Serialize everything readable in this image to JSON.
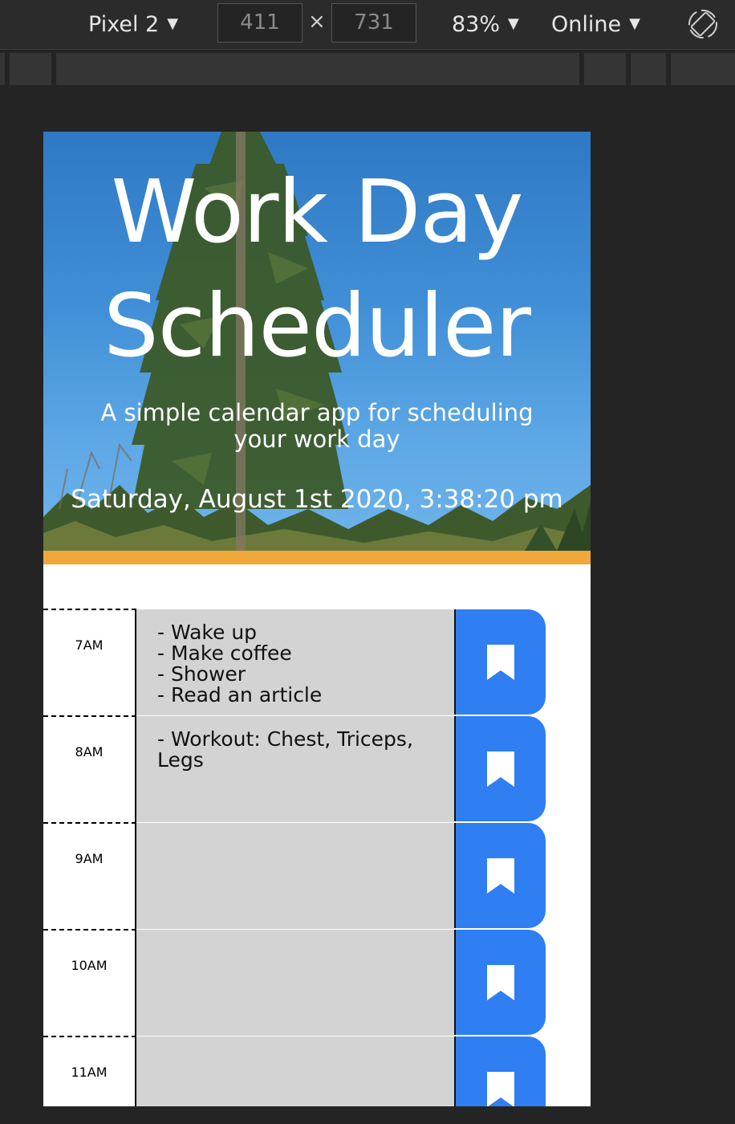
{
  "devtools": {
    "device": "Pixel 2",
    "width": "411",
    "height": "731",
    "zoom": "83%",
    "network": "Online",
    "times_symbol": "×",
    "caret": "▼"
  },
  "app": {
    "title_line1": "Work Day",
    "title_line2": "Scheduler",
    "lead": "A simple calendar app for scheduling your work day",
    "current_date": "Saturday, August 1st 2020, 3:38:20 pm"
  },
  "colors": {
    "accent_border": "#f0a83a",
    "save_button": "#2f7ef2",
    "description_bg": "#d3d3d3"
  },
  "schedule": {
    "blocks": [
      {
        "hour": "7AM",
        "description": "- Wake up\n- Make coffee\n- Shower\n- Read an article"
      },
      {
        "hour": "8AM",
        "description": "- Workout: Chest, Triceps, Legs"
      },
      {
        "hour": "9AM",
        "description": ""
      },
      {
        "hour": "10AM",
        "description": ""
      },
      {
        "hour": "11AM",
        "description": ""
      }
    ],
    "save_icon": "bookmark-icon"
  }
}
